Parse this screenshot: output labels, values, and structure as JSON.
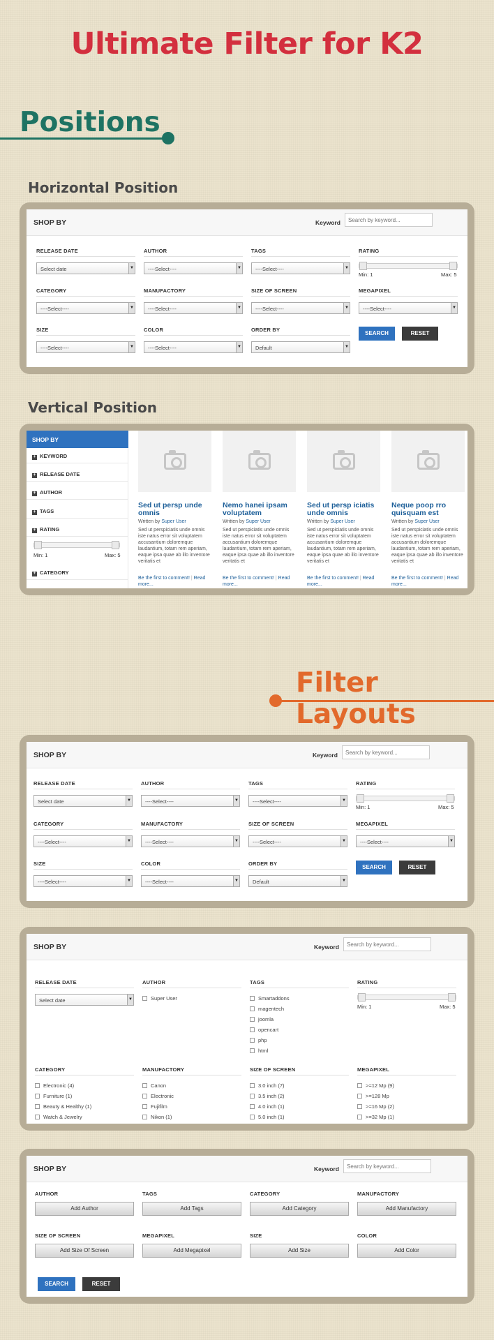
{
  "title": "Ultimate Filter for K2",
  "positions_heading": "Positions",
  "horizontal_heading": "Horizontal Position",
  "vertical_heading": "Vertical Position",
  "layouts_heading": "Filter Layouts",
  "common": {
    "shop_by": "SHOP BY",
    "keyword_label": "Keyword",
    "keyword_placeholder": "Search by keyword...",
    "min_label": "Min: 1",
    "max_label": "Max: 5",
    "search": "SEARCH",
    "reset": "RESET"
  },
  "labels": {
    "release_date": "RELEASE DATE",
    "author": "AUTHOR",
    "tags": "TAGS",
    "rating": "RATING",
    "category": "CATEGORY",
    "manufactory": "MANUFACTORY",
    "size_of_screen": "SIZE OF SCREEN",
    "megapixel": "MEGAPIXEL",
    "size": "SIZE",
    "color": "COLOR",
    "order_by": "ORDER BY"
  },
  "values": {
    "select_date": "Select date",
    "select": "----Select----",
    "default": "Default"
  },
  "sidebar": {
    "head": "SHOP BY",
    "items": [
      "KEYWORD",
      "RELEASE DATE",
      "AUTHOR",
      "TAGS",
      "RATING",
      "CATEGORY"
    ]
  },
  "cards": [
    {
      "title": "Sed ut persp unde omnis",
      "by": "Written by",
      "author": "Super User",
      "text": "Sed ut perspiciatis unde omnis iste natus error sit voluptatem accusantium doloremque laudantium, totam rem aperiam, eaque ipsa quae ab illo inventore veritatis et",
      "comment": "Be the first to comment!",
      "read": "Read more..."
    },
    {
      "title": "Nemo hanei ipsam voluptatem",
      "by": "Written by",
      "author": "Super User",
      "text": "Sed ut perspiciatis unde omnis iste natus error sit voluptatem accusantium doloremque laudantium, totam rem aperiam, eaque ipsa quae ab illo inventore veritatis et",
      "comment": "Be the first to comment!",
      "read": "Read more..."
    },
    {
      "title": "Sed ut persp iciatis unde omnis",
      "by": "Written by",
      "author": "Super User",
      "text": "Sed ut perspiciatis unde omnis iste natus error sit voluptatem accusantium doloremque laudantium, totam rem aperiam, eaque ipsa quae ab illo inventore veritatis et",
      "comment": "Be the first to comment!",
      "read": "Read more..."
    },
    {
      "title": "Neque poop rro quisquam est",
      "by": "Written by",
      "author": "Super User",
      "text": "Sed ut perspiciatis unde omnis iste natus error sit voluptatem accusantium doloremque laudantium, totam rem aperiam, eaque ipsa quae ab illo inventore veritatis et",
      "comment": "Be the first to comment!",
      "read": "Read more..."
    }
  ],
  "checkboxes": {
    "author": [
      "Super User"
    ],
    "tags": [
      "Smartaddons",
      "magentech",
      "joomla",
      "opencart",
      "php",
      "html"
    ],
    "category": [
      "Electronic (4)",
      "Furniture (1)",
      "Beauty & Healthy (1)",
      "Watch & Jewelry"
    ],
    "manufactory": [
      "Canon",
      "Electronic",
      "Fujifilm",
      "Nikon (1)"
    ],
    "size_of_screen": [
      "3.0 inch (7)",
      "3.5 inch (2)",
      "4.0 inch (1)",
      "5.0 inch (1)"
    ],
    "megapixel": [
      ">=12 Mp (9)",
      ">=128 Mp",
      ">=16 Mp (2)",
      ">=32 Mp (1)"
    ]
  },
  "add_buttons": {
    "author": "Add Author",
    "tags": "Add Tags",
    "category": "Add Category",
    "manufactory": "Add Manufactory",
    "size_of_screen": "Add Size Of Screen",
    "megapixel": "Add Megapixel",
    "size": "Add Size",
    "color": "Add Color"
  },
  "colors": {
    "title_red": "#d32f3e",
    "positions_green": "#1e7363",
    "layouts_orange": "#e2692b",
    "frame": "#b7ad97",
    "button_blue": "#2f72bf",
    "button_dark": "#3b3b3b"
  }
}
